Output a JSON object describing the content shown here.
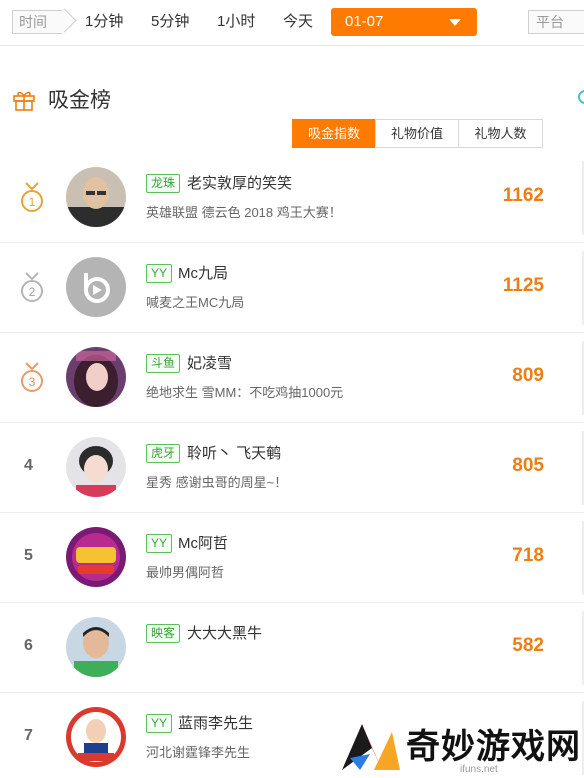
{
  "filters": {
    "time_label": "时间",
    "ranges": [
      "1分钟",
      "5分钟",
      "1小时",
      "今天"
    ],
    "date_value": "01-07",
    "platform_label": "平台"
  },
  "header": {
    "title": "吸金榜"
  },
  "sort_tabs": [
    {
      "label": "吸金指数",
      "active": true
    },
    {
      "label": "礼物价值",
      "active": false
    },
    {
      "label": "礼物人数",
      "active": false
    }
  ],
  "ranking": [
    {
      "rank": "1",
      "platform": "龙珠",
      "name": "老实敦厚的笑笑",
      "room": "英雄联盟 德云色 2018 鸡王大赛！",
      "score": "1162"
    },
    {
      "rank": "2",
      "platform": "YY",
      "name": "Mc九局",
      "room": "喊麦之王MC九局",
      "score": "1125"
    },
    {
      "rank": "3",
      "platform": "斗鱼",
      "name": "妃凌雪",
      "room": "绝地求生 雪MM：不吃鸡抽1000元",
      "score": "809"
    },
    {
      "rank": "4",
      "platform": "虎牙",
      "name": "聆听丶 飞天鹌",
      "room": "星秀 感谢虫哥的周星~！",
      "score": "805"
    },
    {
      "rank": "5",
      "platform": "YY",
      "name": "Mc阿哲",
      "room": "最帅男偶阿哲",
      "score": "718"
    },
    {
      "rank": "6",
      "platform": "映客",
      "name": "大大大黑牛",
      "room": "",
      "score": "582"
    },
    {
      "rank": "7",
      "platform": "YY",
      "name": "蓝雨李先生",
      "room": "河北谢霆锋李先生",
      "score": ""
    }
  ],
  "watermark": {
    "text": "奇妙游戏网",
    "sub": "ifuns.net"
  },
  "colors": {
    "accent": "#ff7a00",
    "score": "#f07d12",
    "badge_green": "#3aa33a"
  }
}
